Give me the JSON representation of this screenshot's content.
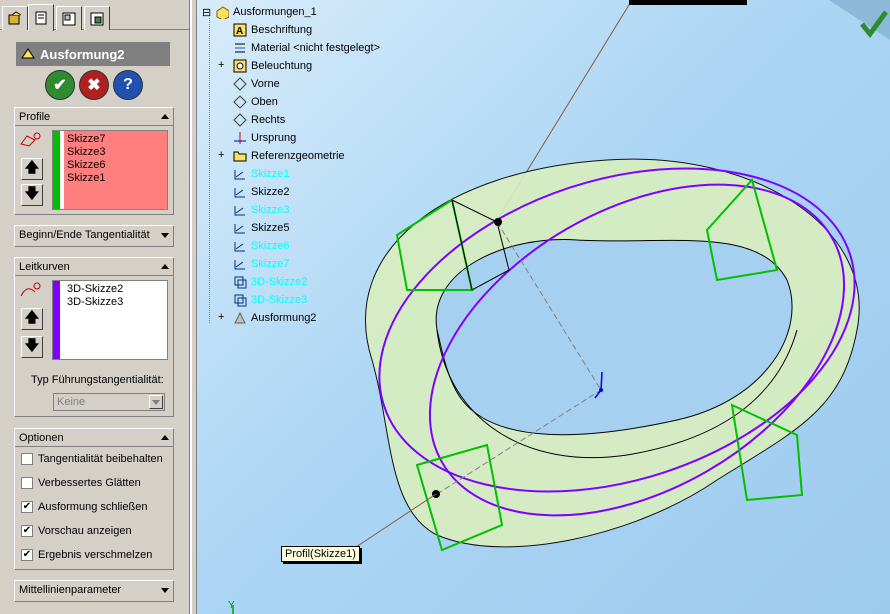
{
  "feature_manager": {
    "title": "Ausformung2",
    "ok_label": "✔",
    "cancel_label": "✖",
    "help_label": "?"
  },
  "groups": {
    "profile": {
      "title": "Profile",
      "items": [
        "Skizze7",
        "Skizze3",
        "Skizze6",
        "Skizze1"
      ]
    },
    "tangency": {
      "title": "Beginn/Ende Tangentialität"
    },
    "guides": {
      "title": "Leitkurven",
      "items": [
        "3D-Skizze2",
        "3D-Skizze3"
      ],
      "type_label": "Typ Führungstangentialität:",
      "type_value": "Keine"
    },
    "options": {
      "title": "Optionen",
      "items": [
        {
          "label": "Tangentialität beibehalten",
          "checked": false
        },
        {
          "label": "Verbessertes Glätten",
          "checked": false
        },
        {
          "label": "Ausformung schließen",
          "checked": true
        },
        {
          "label": "Vorschau anzeigen",
          "checked": true
        },
        {
          "label": "Ergebnis verschmelzen",
          "checked": true
        }
      ]
    },
    "centerline": {
      "title": "Mittellinienparameter"
    }
  },
  "tree": {
    "root": "Ausformungen_1",
    "items": [
      {
        "label": "Beschriftung",
        "icon": "annotation-icon",
        "color": "#000000"
      },
      {
        "label": "Material <nicht festgelegt>",
        "icon": "material-icon",
        "color": "#000000"
      },
      {
        "label": "Beleuchtung",
        "icon": "lighting-icon",
        "color": "#000000",
        "expand": true
      },
      {
        "label": "Vorne",
        "icon": "plane-icon",
        "color": "#000000"
      },
      {
        "label": "Oben",
        "icon": "plane-icon",
        "color": "#000000"
      },
      {
        "label": "Rechts",
        "icon": "plane-icon",
        "color": "#000000"
      },
      {
        "label": "Ursprung",
        "icon": "origin-icon",
        "color": "#000000"
      },
      {
        "label": "Referenzgeometrie",
        "icon": "folder-icon",
        "color": "#000000",
        "expand": true
      },
      {
        "label": "Skizze1",
        "icon": "sketch-icon",
        "color": "#00ffff"
      },
      {
        "label": "Skizze2",
        "icon": "sketch-icon",
        "color": "#000000"
      },
      {
        "label": "Skizze3",
        "icon": "sketch-icon",
        "color": "#00ffff"
      },
      {
        "label": "Skizze5",
        "icon": "sketch-icon",
        "color": "#000000"
      },
      {
        "label": "Skizze6",
        "icon": "sketch-icon",
        "color": "#00ffff"
      },
      {
        "label": "Skizze7",
        "icon": "sketch-icon",
        "color": "#00ffff"
      },
      {
        "label": "3D-Skizze2",
        "icon": "3d-sketch-icon",
        "color": "#00ffff"
      },
      {
        "label": "3D-Skizze3",
        "icon": "3d-sketch-icon",
        "color": "#00ffff"
      },
      {
        "label": "Ausformung2",
        "icon": "loft-icon",
        "color": "#000000",
        "expand": true
      }
    ]
  },
  "viewport": {
    "callout": "Profil(Skizze1)",
    "axis_label": "Y"
  }
}
